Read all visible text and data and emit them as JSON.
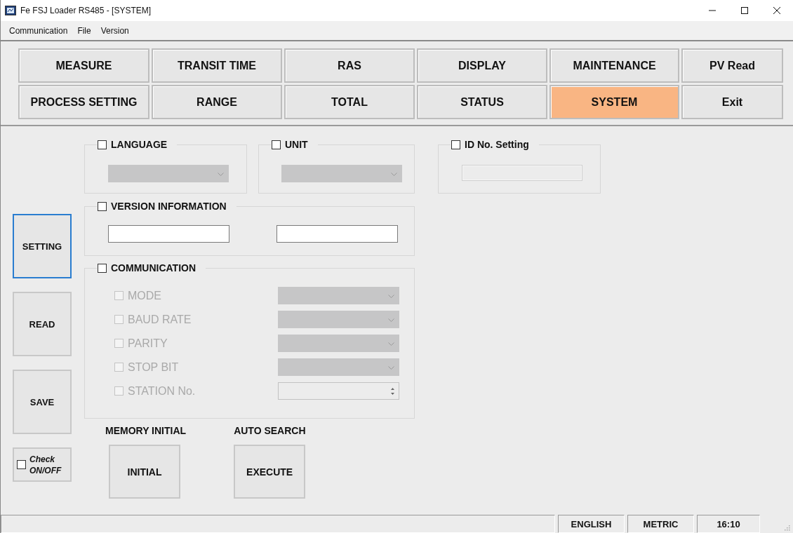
{
  "window": {
    "title": "Fe FSJ Loader RS485 - [SYSTEM]"
  },
  "menu": [
    "Communication",
    "File",
    "Version"
  ],
  "nav_buttons": [
    {
      "label": "MEASURE",
      "selected": false
    },
    {
      "label": "TRANSIT TIME",
      "selected": false
    },
    {
      "label": "RAS",
      "selected": false
    },
    {
      "label": "DISPLAY",
      "selected": false
    },
    {
      "label": "MAINTENANCE",
      "selected": false
    },
    {
      "label": "PV Read",
      "selected": false
    },
    {
      "label": "PROCESS SETTING",
      "selected": false
    },
    {
      "label": "RANGE",
      "selected": false
    },
    {
      "label": "TOTAL",
      "selected": false
    },
    {
      "label": "STATUS",
      "selected": false
    },
    {
      "label": "SYSTEM",
      "selected": true
    },
    {
      "label": "Exit",
      "selected": false
    }
  ],
  "side_buttons": [
    {
      "label": "SETTING",
      "focused": true
    },
    {
      "label": "READ",
      "focused": false
    },
    {
      "label": "SAVE",
      "focused": false
    }
  ],
  "check_toggle": {
    "label": "Check ON/OFF",
    "checked": false
  },
  "language": {
    "label": "LANGUAGE",
    "checked": false,
    "dropdown_disabled": true
  },
  "unit": {
    "label": "UNIT",
    "checked": false,
    "dropdown_disabled": true
  },
  "id_setting": {
    "label": "ID No. Setting",
    "checked": false,
    "field_disabled": true
  },
  "version_information": {
    "label": "VERSION INFORMATION",
    "checked": false,
    "fields": [
      {
        "disabled": false
      },
      {
        "disabled": false
      }
    ]
  },
  "communication": {
    "label": "COMMUNICATION",
    "checked": false,
    "items": [
      {
        "label": "MODE",
        "kind": "dropdown",
        "checked": false,
        "disabled": true
      },
      {
        "label": "BAUD RATE",
        "kind": "dropdown",
        "checked": false,
        "disabled": true
      },
      {
        "label": "PARITY",
        "kind": "dropdown",
        "checked": false,
        "disabled": true
      },
      {
        "label": "STOP BIT",
        "kind": "dropdown",
        "checked": false,
        "disabled": true
      },
      {
        "label": "STATION No.",
        "kind": "spinner",
        "checked": false,
        "disabled": true
      }
    ]
  },
  "memory_initial": {
    "heading": "MEMORY INITIAL",
    "button": "INITIAL"
  },
  "auto_search": {
    "heading": "AUTO SEARCH",
    "button": "EXECUTE"
  },
  "status_bar": [
    "ENGLISH",
    "METRIC",
    "16:10"
  ]
}
